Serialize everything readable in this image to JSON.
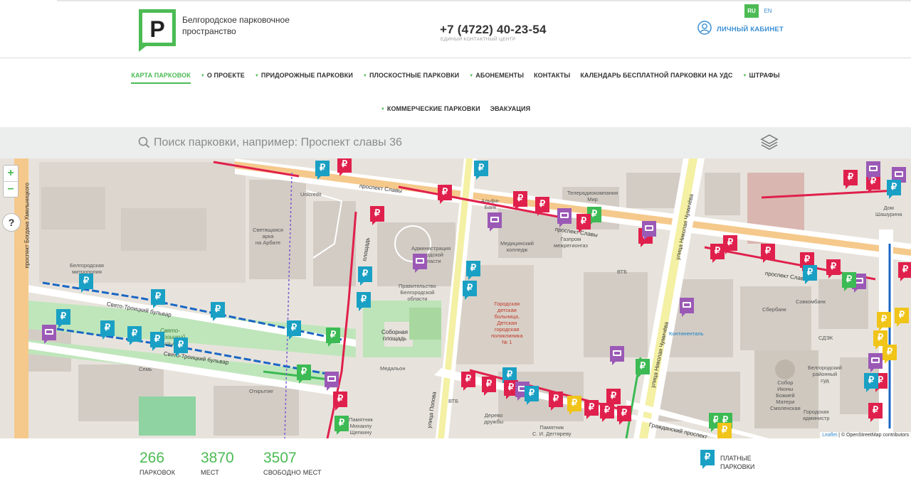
{
  "header": {
    "logo_letter": "P",
    "logo_text": "Белгородское парковочное пространство",
    "phone": "+7 (4722) 40-23-54",
    "phone_caption": "ЕДИНЫЙ КОНТАКТНЫЙ ЦЕНТР",
    "cabinet_label": "ЛИЧНЫЙ КАБИНЕТ",
    "lang_ru": "RU",
    "lang_en": "EN"
  },
  "nav": {
    "row1": [
      {
        "label": "КАРТА ПАРКОВОК",
        "dropdown": false,
        "active": true
      },
      {
        "label": "О ПРОЕКТЕ",
        "dropdown": true
      },
      {
        "label": "ПРИДОРОЖНЫЕ ПАРКОВКИ",
        "dropdown": true
      },
      {
        "label": "ПЛОСКОСТНЫЕ ПАРКОВКИ",
        "dropdown": true
      },
      {
        "label": "АБОНЕМЕНТЫ",
        "dropdown": true
      },
      {
        "label": "КОНТАКТЫ",
        "dropdown": false
      },
      {
        "label": "КАЛЕНДАРЬ БЕСПЛАТНОЙ ПАРКОВКИ НА УДС",
        "dropdown": false
      },
      {
        "label": "ШТРАФЫ",
        "dropdown": true
      }
    ],
    "row2": [
      {
        "label": "КОММЕРЧЕСКИЕ ПАРКОВКИ",
        "dropdown": true
      },
      {
        "label": "ЭВАКУАЦИЯ",
        "dropdown": false
      }
    ]
  },
  "search": {
    "placeholder": "Поиск парковки, например: Проспект славы 36"
  },
  "map": {
    "zoom_in": "+",
    "zoom_out": "−",
    "help": "?",
    "currency_glyph": "₽",
    "attribution_leaflet": "Leaflet",
    "attribution_osm": "© OpenStreetMap",
    "attribution_contrib": "contributors",
    "labels": {
      "unicredit": "Unicredit",
      "arch": "Светящаяся\nарка\nна Арбате",
      "metropolia": "Белгородская\nмитрополия",
      "admin": "Администрация\nгородской\nобласти",
      "government": "Правительство\nБелгородской\nобласти",
      "square": "Соборная\nплощадь",
      "medalon": "Медальон",
      "sem": "Семь",
      "otkrytie": "Открытие",
      "hospital": "Городская\nдетская\nбольница,\nДетская\nгородская\nполиклиника\n№ 1",
      "college": "Медицинский\nколледж",
      "gazprom": "Газпром\nмежрегионгаз",
      "tvmir": "Телерадиокомпания\nМир",
      "vtb": "ВТБ",
      "kontinental": "Континенталь",
      "sberbank": "Сбербанк",
      "sovkombank": "Совкомбанк",
      "sdek": "СДЭК",
      "shashurin": "Дом\nШашурина",
      "sud": "Белгородский\nрайонный\nсуд",
      "sobor": "Собор\nИконы\nБожией\nМатери\nСмоленская",
      "gorad": "Городская\nадминистр",
      "derevo": "Дерево\nдружбы",
      "pamyatnik1": "Памятник\nС. И. Дегтяреву",
      "pamyatnik2": "Памятник\nМихаилу\nЩепкину",
      "vtb2": "ВТБ",
      "alfa": "Альфа-\nБанк"
    },
    "streets": {
      "slavy1": "проспект Славы",
      "slavy2": "проспект Славы",
      "slavy3": "проспект Славы",
      "troitsky1": "Свято-Троицкий бульвар",
      "troitsky2": "Свято-Троицкий бульвар",
      "troitsky_park": "Свято-\nТроицкий\nбульвар",
      "popova": "улица Попова",
      "chumicheva": "улица Николая Чумичёва",
      "chumicheva2": "улица Николая Чумичёва",
      "khmelnitsky": "проспект Богдана Хмельницкого",
      "grazhdansky": "Гражданский проспект",
      "plozhad": "площадь"
    }
  },
  "stats": [
    {
      "value": "266",
      "label": "ПАРКОВОК"
    },
    {
      "value": "3870",
      "label": "МЕСТ"
    },
    {
      "value": "3507",
      "label": "СВОБОДНО МЕСТ"
    }
  ],
  "legend": {
    "label": "ПЛАТНЫЕ ПАРКОВКИ",
    "color": "#1aa0c4"
  },
  "colors": {
    "brand_green": "#4cbb54",
    "paid_red": "#e0204c",
    "paid_blue": "#1aa0c4",
    "commercial_purple": "#9b59b6",
    "free_yellow": "#f0c419"
  }
}
